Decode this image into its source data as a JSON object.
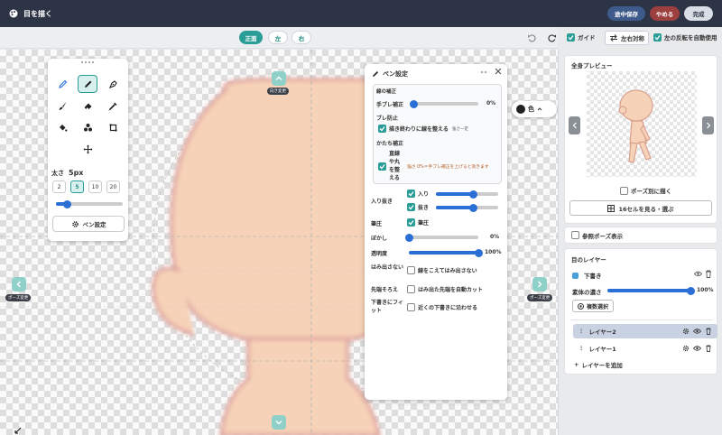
{
  "app": {
    "title": "目を描く"
  },
  "header": {
    "save_label": "途中保存",
    "quit_label": "やめる",
    "done_label": "完成"
  },
  "view_tabs": [
    {
      "label": "正面",
      "active": true
    },
    {
      "label": "左"
    },
    {
      "label": "右"
    }
  ],
  "toolbar": {
    "guide_label": "ガイド",
    "flip_label": "左右対称",
    "auto_flip_label": "左の反転を自動使用"
  },
  "canvas": {
    "top_arrow_label": "向き変更",
    "left_arrow_label": "ポーズ変更",
    "right_arrow_label": "ポーズ変更",
    "color_label": "色"
  },
  "tool_panel": {
    "tools": [
      "pencil-icon",
      "pen-icon",
      "g-pen-icon",
      "brush-icon",
      "eraser-icon",
      "eyedropper-icon",
      "bucket-icon",
      "shapes-icon",
      "crop-icon",
      "move-icon"
    ],
    "size_label": "太さ",
    "size_value": "5px",
    "sizes": [
      "2",
      "5",
      "10",
      "20"
    ],
    "size_slider_fraction": 0.17,
    "pen_settings_button": "ペン設定"
  },
  "pen_settings": {
    "title": "ペン設定",
    "correction_group_label": "線の補正",
    "stabilizer_label": "手ブレ補正",
    "stabilizer_value": "0%",
    "shake_prevent_label": "ブレ防止",
    "tidy_end_label": "描き終わりに線を整える",
    "tidy_end_hint": "強さ一定",
    "shape_correct_label": "かたち補正",
    "straighten_label": "直線や丸を整える",
    "straighten_hint": "強さ 0%＝手ブレ補正を上げると効きます",
    "entry_exit_label": "入り抜き",
    "entry_label": "入り",
    "exit_label": "抜き",
    "pressure_label": "筆圧",
    "pressure_check_label": "筆圧",
    "blur_label": "ぼかし",
    "blur_value": "0%",
    "opacity_label": "透明度",
    "opacity_value": "100%",
    "no_overflow_label": "はみ出さない",
    "no_overflow_option": "線をこえてはみ出さない",
    "tip_align_label": "先端そろえ",
    "tip_align_option": "はみ出た先端を自動カット",
    "fit_sketch_label": "下書きにフィット",
    "fit_sketch_option": "近くの下書きに沿わせる",
    "stabilizer_fraction": 0.0,
    "entry_fraction": 0.6,
    "exit_fraction": 0.6,
    "blur_fraction": 0.0,
    "opacity_fraction": 1.0
  },
  "sidebar": {
    "preview_title": "全身プレビュー",
    "pose_draw_label": "ポーズ別に描く",
    "cells_button": "16セルを見る・選ぶ",
    "ref_pose_label": "参照ポーズ表示",
    "layers_title": "目のレイヤー",
    "sketch_label": "下書き",
    "density_label": "素体の濃さ",
    "density_value": "100%",
    "density_fraction": 1.0,
    "multi_select_label": "複数選択",
    "layers": [
      {
        "name": "レイヤー2",
        "active": true
      },
      {
        "name": "レイヤー1"
      }
    ],
    "add_layer_label": "レイヤーを追加"
  },
  "colors": {
    "accent": "#2a9d96",
    "slider": "#2a6fd6",
    "skin": "#f6d2b8"
  }
}
